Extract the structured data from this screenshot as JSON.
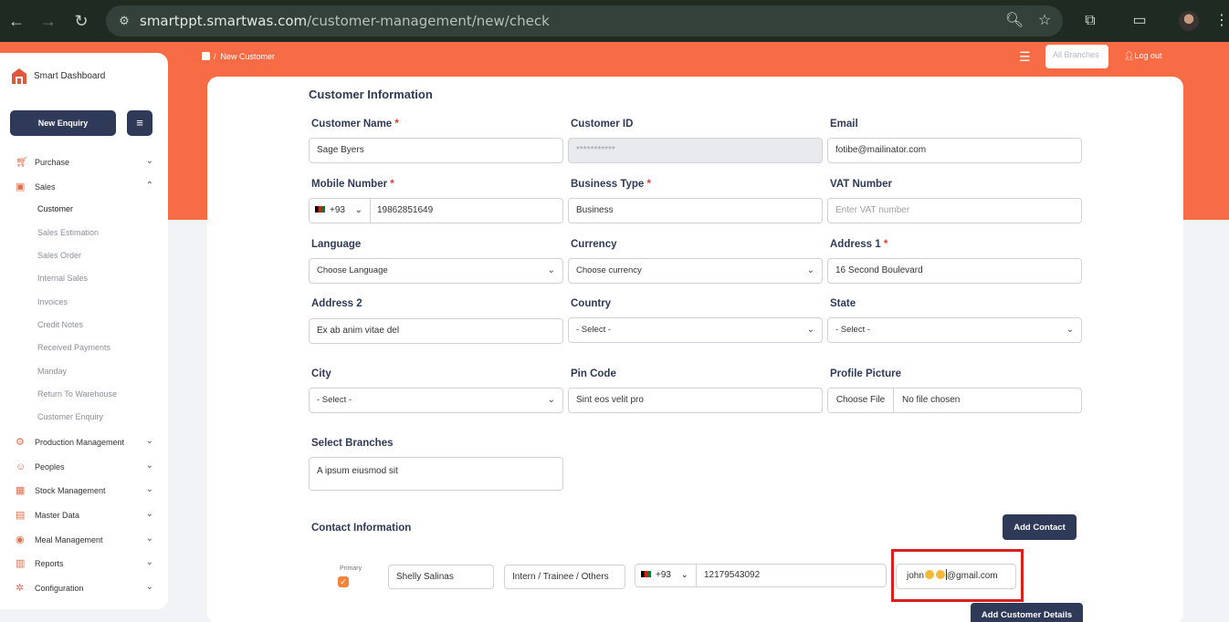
{
  "browser": {
    "url_host": "smartppt.smartwas.com",
    "url_path": "/customer-management/new/check"
  },
  "sidebar": {
    "app_title": "Smart Dashboard",
    "new_enquiry_label": "New Enquiry",
    "items": [
      {
        "label": "Purchase",
        "icon": "cart-icon",
        "expanded": false
      },
      {
        "label": "Sales",
        "icon": "sales-icon",
        "expanded": true
      },
      {
        "label": "Production Management",
        "icon": "production-icon",
        "expanded": false
      },
      {
        "label": "Peoples",
        "icon": "people-icon",
        "expanded": false
      },
      {
        "label": "Stock Management",
        "icon": "stock-icon",
        "expanded": false
      },
      {
        "label": "Master Data",
        "icon": "master-data-icon",
        "expanded": false
      },
      {
        "label": "Meal Management",
        "icon": "meal-icon",
        "expanded": false
      },
      {
        "label": "Reports",
        "icon": "reports-icon",
        "expanded": false
      },
      {
        "label": "Configuration",
        "icon": "configuration-icon",
        "expanded": false
      }
    ],
    "sales_sub": [
      "Customer",
      "Sales Estimation",
      "Sales Order",
      "Internal Sales",
      "Invoices",
      "Credit Notes",
      "Received Payments",
      "Manday",
      "Return To Warehouse",
      "Customer Enquiry"
    ],
    "active_sub": "Customer"
  },
  "topbar": {
    "breadcrumb_sep": "/",
    "breadcrumb_current": "New Customer",
    "branch_select": "All Branches",
    "logout_label": "Log out"
  },
  "form": {
    "section_title": "Customer Information",
    "required_mark": "*",
    "customer_name": {
      "label": "Customer Name",
      "value": "Sage Byers"
    },
    "customer_id": {
      "label": "Customer ID",
      "value": "***********"
    },
    "email": {
      "label": "Email",
      "value": "fotibe@mailinator.com"
    },
    "mobile": {
      "label": "Mobile Number",
      "code": "+93",
      "value": "19862851649"
    },
    "business_type": {
      "label": "Business Type",
      "value": "Business"
    },
    "vat": {
      "label": "VAT Number",
      "placeholder": "Enter VAT number"
    },
    "language": {
      "label": "Language",
      "value": "Choose Language"
    },
    "currency": {
      "label": "Currency",
      "value": "Choose currency"
    },
    "address1": {
      "label": "Address 1",
      "value": "16 Second Boulevard"
    },
    "address2": {
      "label": "Address 2",
      "value": "Ex ab anim vitae del"
    },
    "country": {
      "label": "Country",
      "value": "- Select -"
    },
    "state": {
      "label": "State",
      "value": "- Select -"
    },
    "city": {
      "label": "City",
      "value": "- Select -"
    },
    "pin_code": {
      "label": "Pin Code",
      "value": "Sint eos velit pro"
    },
    "profile_picture": {
      "label": "Profile Picture",
      "button": "Choose File",
      "status": "No file chosen"
    },
    "branches": {
      "label": "Select Branches",
      "value": "A ipsum eiusmod sit"
    }
  },
  "contact": {
    "section_title": "Contact Information",
    "add_contact_label": "Add Contact",
    "primary_label": "Primary",
    "name": "Shelly Salinas",
    "designation": "Intern / Trainee / Others",
    "phone_code": "+93",
    "phone": "12179543092",
    "email_prefix": "john",
    "email_suffix": "@gmail.com",
    "highlight_color": "#d8201e"
  },
  "submit_label": "Add Customer Details",
  "colors": {
    "brand_orange": "#f76b45",
    "navy": "#2e3a57",
    "required": "#e53935"
  }
}
